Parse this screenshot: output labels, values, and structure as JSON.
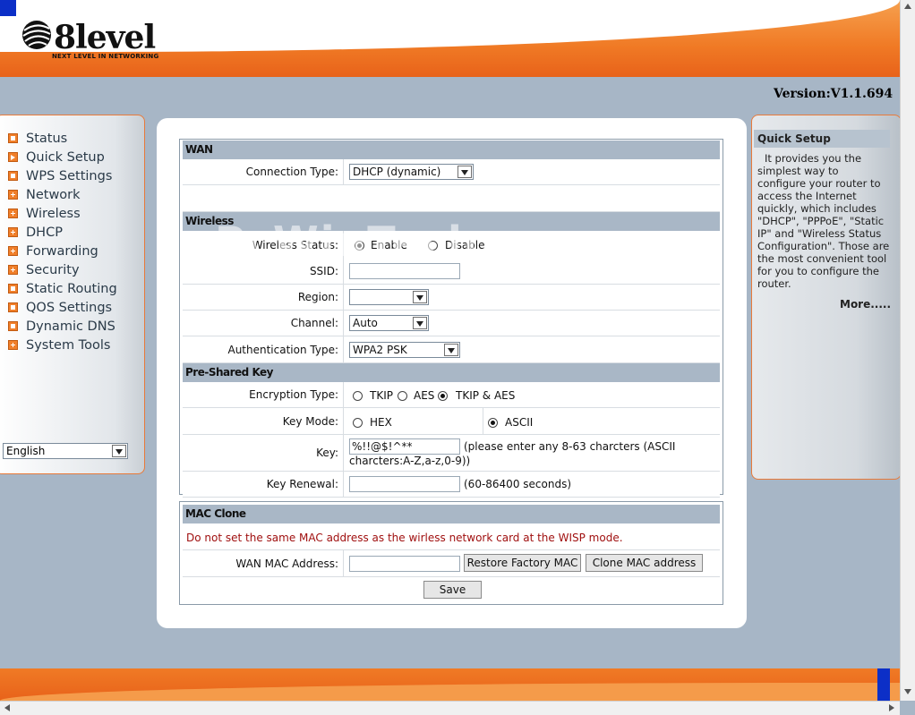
{
  "header": {
    "brand": "8level",
    "tagline": "NEXT LEVEL IN NETWORKING",
    "version": "Version:V1.1.694"
  },
  "menu": {
    "items": [
      {
        "label": "Status",
        "icon": "box-icon"
      },
      {
        "label": "Quick Setup",
        "icon": "arrow-icon"
      },
      {
        "label": "WPS Settings",
        "icon": "box-icon"
      },
      {
        "label": "Network",
        "icon": "plus-icon"
      },
      {
        "label": "Wireless",
        "icon": "plus-icon"
      },
      {
        "label": "DHCP",
        "icon": "plus-icon"
      },
      {
        "label": "Forwarding",
        "icon": "plus-icon"
      },
      {
        "label": "Security",
        "icon": "plus-icon"
      },
      {
        "label": "Static Routing",
        "icon": "box-icon"
      },
      {
        "label": "QOS Settings",
        "icon": "box-icon"
      },
      {
        "label": "Dynamic DNS",
        "icon": "box-icon"
      },
      {
        "label": "System Tools",
        "icon": "plus-icon"
      }
    ],
    "language": "English"
  },
  "wan": {
    "title": "WAN",
    "connection_type_label": "Connection Type:",
    "connection_type_value": "DHCP (dynamic)"
  },
  "wireless": {
    "title": "Wireless",
    "status_label": "Wireless Status:",
    "enable": "Enable",
    "disable": "Disable",
    "ssid_label": "SSID:",
    "region_label": "Region:",
    "channel_label": "Channel:",
    "channel_value": "Auto",
    "auth_label": "Authentication Type:",
    "auth_value": "WPA2 PSK"
  },
  "psk": {
    "title": "Pre-Shared Key",
    "enc_label": "Encryption Type:",
    "enc_tkip": "TKIP",
    "enc_aes": "AES",
    "enc_both": "TKIP & AES",
    "keymode_label": "Key Mode:",
    "hex": "HEX",
    "ascii": "ASCII",
    "key_label": "Key:",
    "key_value": "%!!@$!^**",
    "key_hint": "(please enter any 8-63 charcters (ASCII charcters:A-Z,a-z,0-9))",
    "renewal_label": "Key Renewal:",
    "renewal_hint": "(60-86400 seconds)"
  },
  "mac": {
    "title": "MAC Clone",
    "warning": "Do not set the same MAC address as the wirless network card at the WISP mode.",
    "wan_mac_label": "WAN MAC Address:",
    "restore_btn": "Restore Factory MAC",
    "clone_btn": "Clone MAC address",
    "save_btn": "Save"
  },
  "quick_setup": {
    "title": "Quick Setup",
    "text": "It provides you the simplest way to configure your router to access the Internet quickly, which includes \"DHCP\", \"PPPoE\", \"Static IP\" and \"Wireless Status Configuration\". Those are the most convenient tool for you to configure the router.",
    "more": "More....."
  },
  "watermark": "PcWinTech.com",
  "colors": {
    "accent": "#f07a25",
    "background": "#a7b6c6",
    "section_header": "#a9b7c6",
    "warning": "#a01010"
  }
}
